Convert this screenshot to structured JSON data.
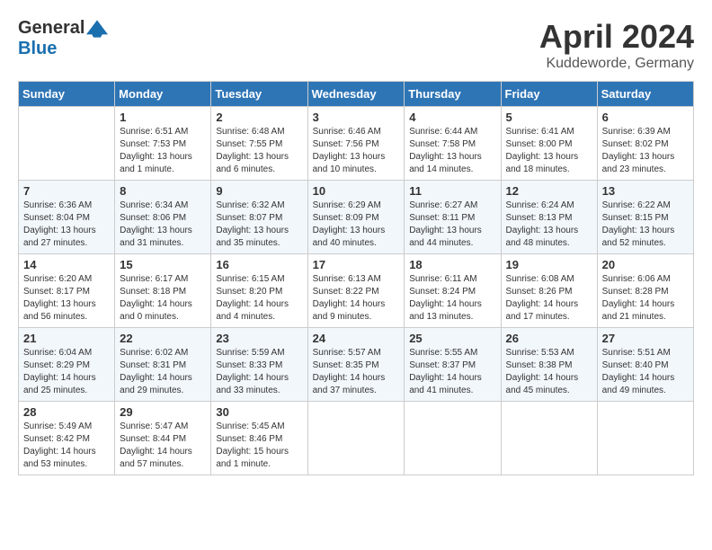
{
  "header": {
    "logo_general": "General",
    "logo_blue": "Blue",
    "month_title": "April 2024",
    "subtitle": "Kuddeworde, Germany"
  },
  "days_of_week": [
    "Sunday",
    "Monday",
    "Tuesday",
    "Wednesday",
    "Thursday",
    "Friday",
    "Saturday"
  ],
  "weeks": [
    [
      {
        "day": "",
        "sunrise": "",
        "sunset": "",
        "daylight": ""
      },
      {
        "day": "1",
        "sunrise": "Sunrise: 6:51 AM",
        "sunset": "Sunset: 7:53 PM",
        "daylight": "Daylight: 13 hours and 1 minute."
      },
      {
        "day": "2",
        "sunrise": "Sunrise: 6:48 AM",
        "sunset": "Sunset: 7:55 PM",
        "daylight": "Daylight: 13 hours and 6 minutes."
      },
      {
        "day": "3",
        "sunrise": "Sunrise: 6:46 AM",
        "sunset": "Sunset: 7:56 PM",
        "daylight": "Daylight: 13 hours and 10 minutes."
      },
      {
        "day": "4",
        "sunrise": "Sunrise: 6:44 AM",
        "sunset": "Sunset: 7:58 PM",
        "daylight": "Daylight: 13 hours and 14 minutes."
      },
      {
        "day": "5",
        "sunrise": "Sunrise: 6:41 AM",
        "sunset": "Sunset: 8:00 PM",
        "daylight": "Daylight: 13 hours and 18 minutes."
      },
      {
        "day": "6",
        "sunrise": "Sunrise: 6:39 AM",
        "sunset": "Sunset: 8:02 PM",
        "daylight": "Daylight: 13 hours and 23 minutes."
      }
    ],
    [
      {
        "day": "7",
        "sunrise": "Sunrise: 6:36 AM",
        "sunset": "Sunset: 8:04 PM",
        "daylight": "Daylight: 13 hours and 27 minutes."
      },
      {
        "day": "8",
        "sunrise": "Sunrise: 6:34 AM",
        "sunset": "Sunset: 8:06 PM",
        "daylight": "Daylight: 13 hours and 31 minutes."
      },
      {
        "day": "9",
        "sunrise": "Sunrise: 6:32 AM",
        "sunset": "Sunset: 8:07 PM",
        "daylight": "Daylight: 13 hours and 35 minutes."
      },
      {
        "day": "10",
        "sunrise": "Sunrise: 6:29 AM",
        "sunset": "Sunset: 8:09 PM",
        "daylight": "Daylight: 13 hours and 40 minutes."
      },
      {
        "day": "11",
        "sunrise": "Sunrise: 6:27 AM",
        "sunset": "Sunset: 8:11 PM",
        "daylight": "Daylight: 13 hours and 44 minutes."
      },
      {
        "day": "12",
        "sunrise": "Sunrise: 6:24 AM",
        "sunset": "Sunset: 8:13 PM",
        "daylight": "Daylight: 13 hours and 48 minutes."
      },
      {
        "day": "13",
        "sunrise": "Sunrise: 6:22 AM",
        "sunset": "Sunset: 8:15 PM",
        "daylight": "Daylight: 13 hours and 52 minutes."
      }
    ],
    [
      {
        "day": "14",
        "sunrise": "Sunrise: 6:20 AM",
        "sunset": "Sunset: 8:17 PM",
        "daylight": "Daylight: 13 hours and 56 minutes."
      },
      {
        "day": "15",
        "sunrise": "Sunrise: 6:17 AM",
        "sunset": "Sunset: 8:18 PM",
        "daylight": "Daylight: 14 hours and 0 minutes."
      },
      {
        "day": "16",
        "sunrise": "Sunrise: 6:15 AM",
        "sunset": "Sunset: 8:20 PM",
        "daylight": "Daylight: 14 hours and 4 minutes."
      },
      {
        "day": "17",
        "sunrise": "Sunrise: 6:13 AM",
        "sunset": "Sunset: 8:22 PM",
        "daylight": "Daylight: 14 hours and 9 minutes."
      },
      {
        "day": "18",
        "sunrise": "Sunrise: 6:11 AM",
        "sunset": "Sunset: 8:24 PM",
        "daylight": "Daylight: 14 hours and 13 minutes."
      },
      {
        "day": "19",
        "sunrise": "Sunrise: 6:08 AM",
        "sunset": "Sunset: 8:26 PM",
        "daylight": "Daylight: 14 hours and 17 minutes."
      },
      {
        "day": "20",
        "sunrise": "Sunrise: 6:06 AM",
        "sunset": "Sunset: 8:28 PM",
        "daylight": "Daylight: 14 hours and 21 minutes."
      }
    ],
    [
      {
        "day": "21",
        "sunrise": "Sunrise: 6:04 AM",
        "sunset": "Sunset: 8:29 PM",
        "daylight": "Daylight: 14 hours and 25 minutes."
      },
      {
        "day": "22",
        "sunrise": "Sunrise: 6:02 AM",
        "sunset": "Sunset: 8:31 PM",
        "daylight": "Daylight: 14 hours and 29 minutes."
      },
      {
        "day": "23",
        "sunrise": "Sunrise: 5:59 AM",
        "sunset": "Sunset: 8:33 PM",
        "daylight": "Daylight: 14 hours and 33 minutes."
      },
      {
        "day": "24",
        "sunrise": "Sunrise: 5:57 AM",
        "sunset": "Sunset: 8:35 PM",
        "daylight": "Daylight: 14 hours and 37 minutes."
      },
      {
        "day": "25",
        "sunrise": "Sunrise: 5:55 AM",
        "sunset": "Sunset: 8:37 PM",
        "daylight": "Daylight: 14 hours and 41 minutes."
      },
      {
        "day": "26",
        "sunrise": "Sunrise: 5:53 AM",
        "sunset": "Sunset: 8:38 PM",
        "daylight": "Daylight: 14 hours and 45 minutes."
      },
      {
        "day": "27",
        "sunrise": "Sunrise: 5:51 AM",
        "sunset": "Sunset: 8:40 PM",
        "daylight": "Daylight: 14 hours and 49 minutes."
      }
    ],
    [
      {
        "day": "28",
        "sunrise": "Sunrise: 5:49 AM",
        "sunset": "Sunset: 8:42 PM",
        "daylight": "Daylight: 14 hours and 53 minutes."
      },
      {
        "day": "29",
        "sunrise": "Sunrise: 5:47 AM",
        "sunset": "Sunset: 8:44 PM",
        "daylight": "Daylight: 14 hours and 57 minutes."
      },
      {
        "day": "30",
        "sunrise": "Sunrise: 5:45 AM",
        "sunset": "Sunset: 8:46 PM",
        "daylight": "Daylight: 15 hours and 1 minute."
      },
      {
        "day": "",
        "sunrise": "",
        "sunset": "",
        "daylight": ""
      },
      {
        "day": "",
        "sunrise": "",
        "sunset": "",
        "daylight": ""
      },
      {
        "day": "",
        "sunrise": "",
        "sunset": "",
        "daylight": ""
      },
      {
        "day": "",
        "sunrise": "",
        "sunset": "",
        "daylight": ""
      }
    ]
  ]
}
